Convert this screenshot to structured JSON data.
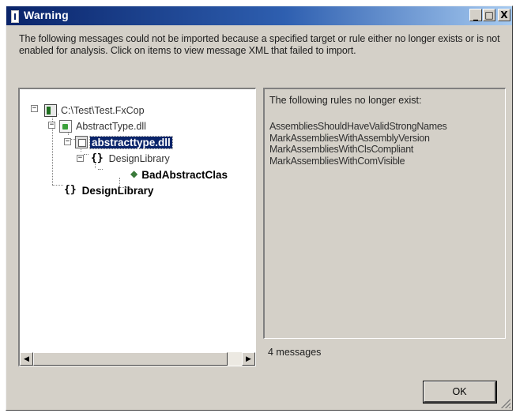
{
  "window": {
    "title": "Warning",
    "controls": {
      "minimize": "_",
      "maximize": "□",
      "close": "X"
    }
  },
  "description": "The following messages could not be imported because a specified target or rule either no longer exists or is not enabled for analysis. Click on items to view message XML that failed to import.",
  "tree": {
    "nodes": [
      {
        "label": "C:\\Test\\Test.FxCop",
        "icon": "project-icon",
        "expander": "−"
      },
      {
        "label": "AbstractType.dll",
        "icon": "assembly-file-icon",
        "expander": "−"
      },
      {
        "label": "abstracttype.dll",
        "icon": "module-icon",
        "expander": "−",
        "selected": true
      },
      {
        "label": "DesignLibrary",
        "icon": "namespace-icon",
        "expander": "−"
      },
      {
        "label": "BadAbstractClas",
        "icon": "type-icon"
      },
      {
        "label": "DesignLibrary",
        "icon": "namespace-icon"
      }
    ]
  },
  "scrollbar": {
    "left_arrow": "◀",
    "right_arrow": "▶"
  },
  "messages_panel": {
    "header": "The following rules no longer exist:",
    "rules": [
      "AssembliesShouldHaveValidStrongNames",
      "MarkAssembliesWithAssemblyVersion",
      "MarkAssembliesWithClsCompliant",
      "MarkAssembliesWithComVisible"
    ]
  },
  "message_count": "4 messages",
  "ok_label": "OK"
}
